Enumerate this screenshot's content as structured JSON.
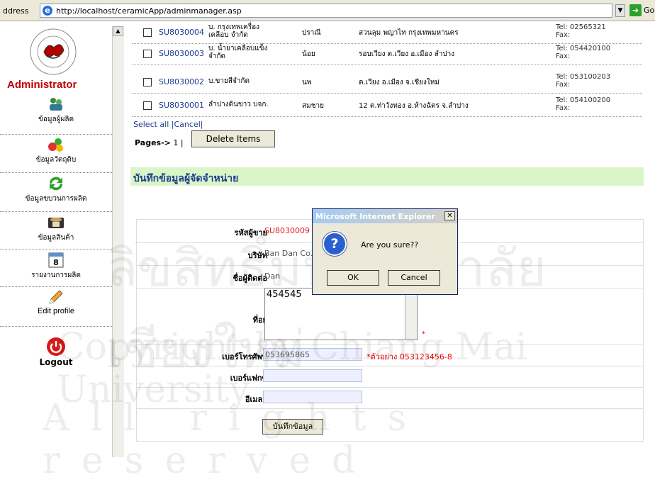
{
  "browser": {
    "address_label": "ddress",
    "url": "http://localhost/ceramicApp/adminmanager.asp",
    "go_label": "Go"
  },
  "sidebar": {
    "title": "Administrator",
    "items": [
      {
        "label": "ข้อมูลผู้ผลิต",
        "icon": "people-icon"
      },
      {
        "label": "ข้อมูลวัตถุดิบ",
        "icon": "materials-icon"
      },
      {
        "label": "ข้อมูลขบวนการผลิต",
        "icon": "recycle-icon"
      },
      {
        "label": "ข้อมูลสินค้า",
        "icon": "product-icon"
      },
      {
        "label": "รายงานการผลิต",
        "icon": "calendar-icon"
      },
      {
        "label": "Edit profile",
        "icon": "pencil-icon"
      }
    ],
    "calendar_day": "8",
    "logout_label": "Logout"
  },
  "suppliers": [
    {
      "code": "SU8030004",
      "company": "บ. กรุงเทพเครื่องเคลือบ จำกัด",
      "contact": "ปราณี",
      "address": "สวนลุม พญาไท กรุงเทพมหานคร",
      "tel": "Tel: 02565321",
      "fax": "Fax:"
    },
    {
      "code": "SU8030003",
      "company": "บ. น้ำยาเคลือบแข็ง จำกัด",
      "contact": "น้อย",
      "address": "รอบเวียง ต.เวียง อ.เมือง ลำปาง",
      "tel": "Tel: 054420100",
      "fax": "Fax:"
    },
    {
      "code": "SU8030002",
      "company": "บ.ขายสีจำกัด",
      "contact": "นพ",
      "address": "ต.เวียง อ.เมือง จ.เชียงใหม่",
      "tel": "Tel: 053100203",
      "fax": "Fax:"
    },
    {
      "code": "SU8030001",
      "company": "ลำปางดินขาว บจก.",
      "contact": "สมชาย",
      "address": "12 ต.ท่าวังทอง อ.ห้างฉัตร จ.ลำปาง",
      "tel": "Tel: 054100200",
      "fax": "Fax:"
    }
  ],
  "list_controls": {
    "select_all": "Select all",
    "cancel": "Cancel",
    "pages_label": "Pages->",
    "page_number": "1",
    "delete_button": "Delete Items"
  },
  "form": {
    "section_title": "บันทึกข้อมูลผู้จัดจำหน่าย",
    "supplier_id_label": "รหัสผู้ขาย",
    "supplier_id_value": "SU8030009",
    "company_label": "บริษัท",
    "company_value": "Ban Dan Co.",
    "contact_label": "ชื่อผู้ติดต่อ",
    "contact_value": "Dan",
    "address_label": "ที่อยู่",
    "address_value": "454545",
    "phone_label": "เบอร์โทรศัพท์",
    "phone_value": "053695865",
    "phone_hint": "*ตัวอย่าง 053123456-8",
    "fax_label": "เบอร์แฟกซ์",
    "fax_value": "",
    "email_label": "อีเมลล์",
    "email_value": "",
    "save_button": "บันทึกข้อมูล"
  },
  "dialog": {
    "title": "Microsoft Internet Explorer",
    "message": "Are you sure??",
    "ok": "OK",
    "cancel": "Cancel",
    "icon": "question-icon"
  },
  "watermark": {
    "line1": "ลิขสิทธิ์มหาวิทยาลัยเชียงใหม่",
    "line2": "Copyright by Chiang Mai University",
    "line3": "All rights reserved"
  }
}
